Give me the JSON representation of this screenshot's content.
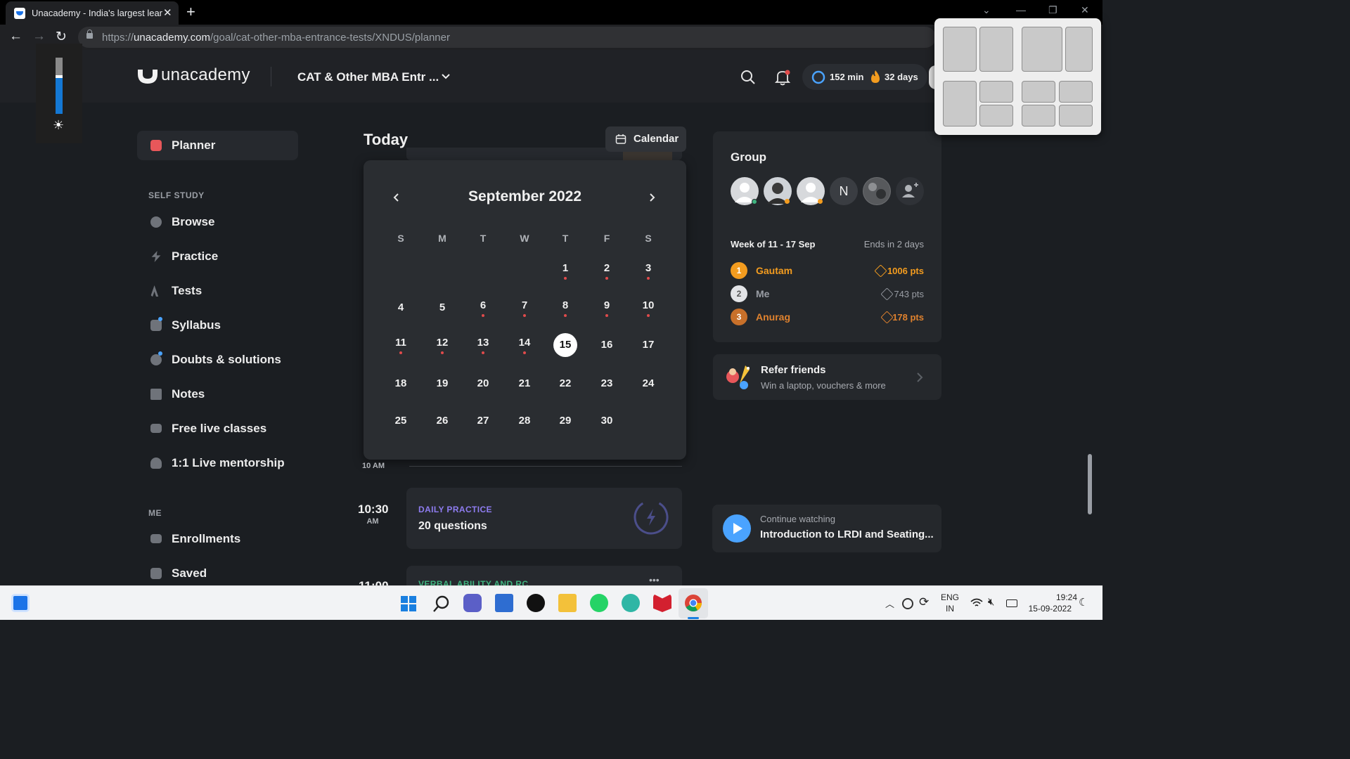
{
  "browser": {
    "tab_title": "Unacademy - India's largest learning platform",
    "url_domain": "unacademy.com",
    "url_prefix": "https://",
    "url_path": "/goal/cat-other-mba-entrance-tests/XNDUS/planner"
  },
  "header": {
    "logo": "unacademy",
    "goal": "CAT & Other MBA Entr ...",
    "watch_time": "152 min",
    "streak": "32 days"
  },
  "sidebar": {
    "active": "Planner",
    "self_study_heading": "SELF STUDY",
    "items": [
      "Browse",
      "Practice",
      "Tests",
      "Syllabus",
      "Doubts & solutions",
      "Notes",
      "Free live classes",
      "1:1 Live mentorship"
    ],
    "me_heading": "ME",
    "me_items": [
      "Enrollments",
      "Saved"
    ]
  },
  "planner": {
    "heading": "Today",
    "calendar_button": "Calendar",
    "calendar": {
      "month": "September 2022",
      "weekdays": [
        "S",
        "M",
        "T",
        "W",
        "T",
        "F",
        "S"
      ],
      "first_weekday_index": 4,
      "days_in_month": 30,
      "selected_day": 15,
      "days_with_events": [
        1,
        2,
        3,
        6,
        7,
        8,
        9,
        10,
        11,
        12,
        13,
        14
      ]
    },
    "time_10am": "10 AM",
    "slot_time": "10:30",
    "slot_ampm": "AM",
    "daily_practice_tag": "DAILY PRACTICE",
    "daily_practice_title": "20 questions",
    "next_slot_time": "11:00",
    "next_slot_tag": "VERBAL ABILITY AND RC"
  },
  "group": {
    "title": "Group",
    "avatar_initial": "N",
    "week": "Week of 11 - 17 Sep",
    "ends": "Ends in 2 days",
    "leaderboard": [
      {
        "rank": "1",
        "name": "Gautam",
        "points": "1006 pts"
      },
      {
        "rank": "2",
        "name": "Me",
        "points": "743 pts"
      },
      {
        "rank": "3",
        "name": "Anurag",
        "points": "178 pts"
      }
    ]
  },
  "refer": {
    "title": "Refer friends",
    "subtitle": "Win a laptop, vouchers & more"
  },
  "continue_watching": {
    "label": "Continue watching",
    "title": "Introduction to LRDI and Seating..."
  },
  "taskbar": {
    "lang_top": "ENG",
    "lang_bottom": "IN",
    "time": "19:24",
    "date": "15-09-2022"
  },
  "colors": {
    "gold": "#f39c1f",
    "silver": "#c9cbd0",
    "bronze": "#c8702a",
    "accent_blue": "#4aa3ff",
    "dot_red": "#e04b4b"
  }
}
